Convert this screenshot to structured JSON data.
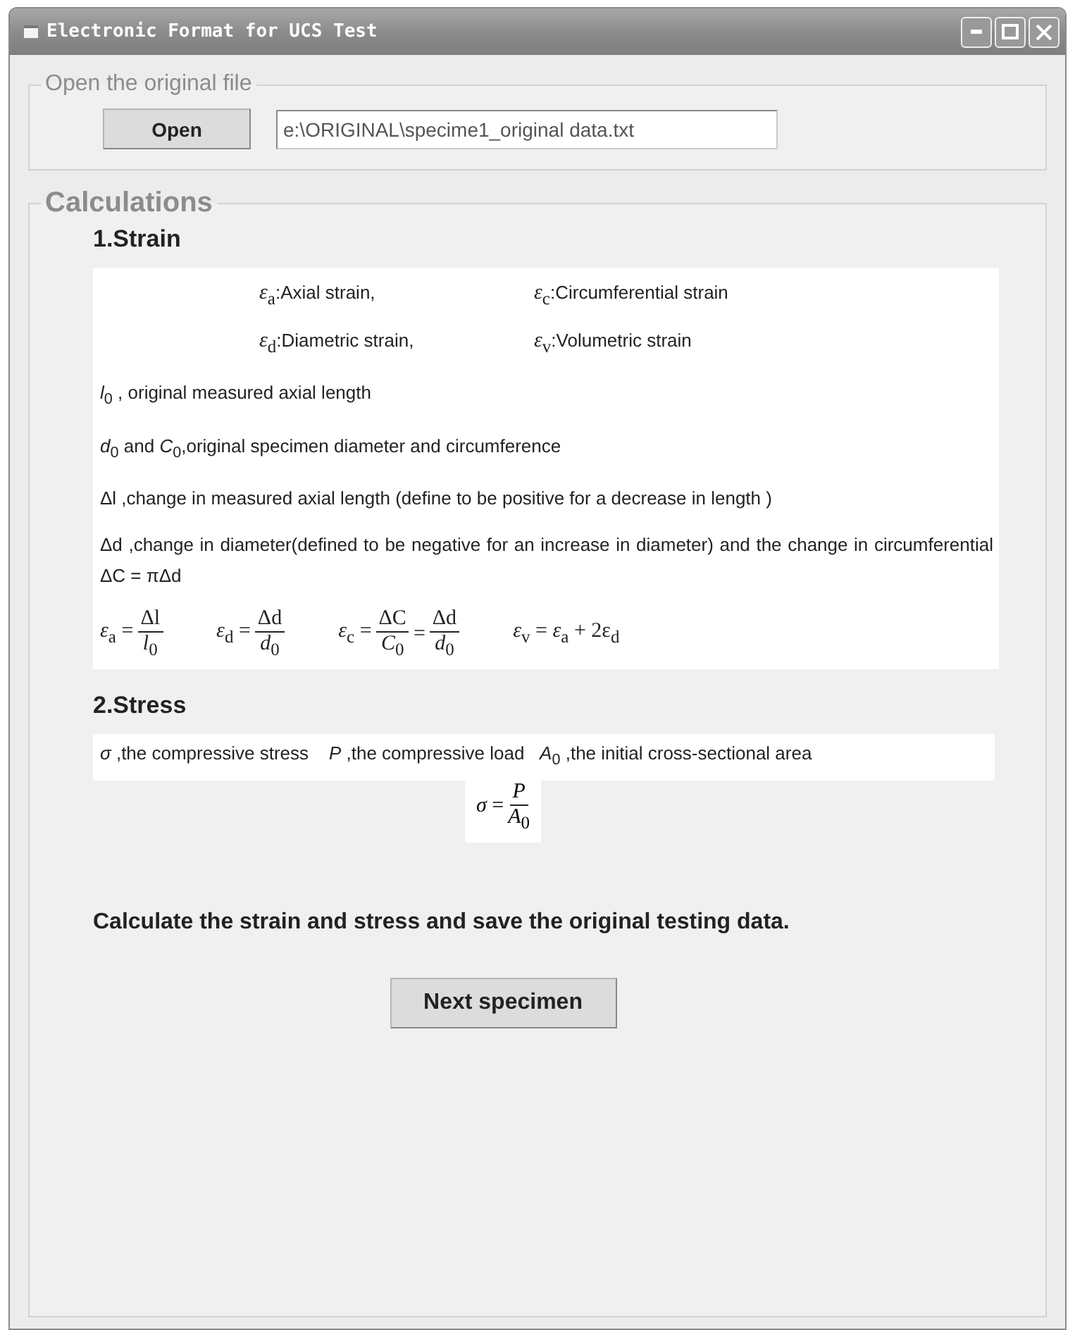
{
  "window": {
    "title": "Electronic Format for UCS Test"
  },
  "open_group": {
    "legend": "Open the original file",
    "button": "Open",
    "path": "e:\\ORIGINAL\\specime1_original data.txt"
  },
  "calculations": {
    "legend": "Calculations",
    "strain": {
      "heading": "1.Strain",
      "symbols": [
        {
          "symbol": "*ε*$_{a}$",
          "text": ":Axial strain,"
        },
        {
          "symbol": "*ε*$_{c}$",
          "text": ":Circumferential strain"
        },
        {
          "symbol": "*ε*$_{d}$",
          "text": ":Diametric strain,"
        },
        {
          "symbol": "*ε*$_{v}$",
          "text": ":Volumetric strain"
        }
      ],
      "lines": [
        "*l*$_{0}$ , original measured axial length",
        "*d*$_{0}$ and *C*$_{0}$,original specimen diameter and circumference",
        "Δl ,change in measured axial length (define to be positive for a decrease in length )",
        "Δd ,change in diameter(defined to be negative for an increase in diameter) and the change in circumferential  ΔC = πΔd"
      ],
      "equations": [
        [
          {
            "kind": "text",
            "text": "*ε*$_{a}$ ="
          },
          {
            "kind": "fraction",
            "num": "Δl",
            "den": "*l*$_{0}$"
          }
        ],
        [
          {
            "kind": "text",
            "text": "*ε*$_{d}$ ="
          },
          {
            "kind": "fraction",
            "num": "Δd",
            "den": "*d*$_{0}$"
          }
        ],
        [
          {
            "kind": "text",
            "text": "*ε*$_{c}$ ="
          },
          {
            "kind": "fraction",
            "num": "ΔC",
            "den": "*C*$_{0}$"
          },
          {
            "kind": "text",
            "text": "="
          },
          {
            "kind": "fraction",
            "num": "Δd",
            "den": "*d*$_{0}$"
          }
        ],
        [
          {
            "kind": "text",
            "text": "*ε*$_{v}$ = *ε*$_{a}$ + 2ε$_{d}$"
          }
        ]
      ]
    },
    "stress": {
      "heading": "2.Stress",
      "line": "*σ* ,the compressive stress    *P* ,the compressive load   *A*$_{0}$ ,the initial cross-sectional area",
      "equation": [
        {
          "kind": "text",
          "text": "*σ* ="
        },
        {
          "kind": "fraction",
          "num": "*P*",
          "den": "*A*$_{0}$"
        }
      ]
    },
    "summary": "Calculate the strain and stress and save the original testing data.",
    "button": "Next specimen"
  }
}
